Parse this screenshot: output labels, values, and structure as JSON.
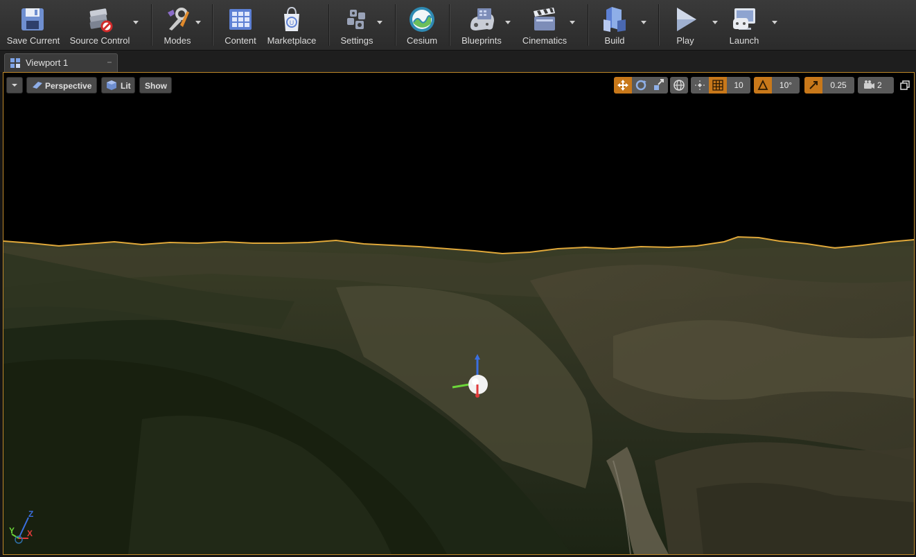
{
  "toolbar": {
    "save_current": "Save Current",
    "source_control": "Source Control",
    "modes": "Modes",
    "content": "Content",
    "marketplace": "Marketplace",
    "settings": "Settings",
    "cesium": "Cesium",
    "blueprints": "Blueprints",
    "cinematics": "Cinematics",
    "build": "Build",
    "play": "Play",
    "launch": "Launch"
  },
  "tab": {
    "label": "Viewport 1"
  },
  "viewport": {
    "perspective_label": "Perspective",
    "lit_label": "Lit",
    "show_label": "Show",
    "grid_snap_value": "10",
    "rotation_snap_value": "10°",
    "scale_snap_value": "0.25",
    "camera_speed_value": "2",
    "axis_labels": {
      "x": "X",
      "y": "Y",
      "z": "Z"
    }
  },
  "colors": {
    "accent_orange": "#c8781a",
    "viewport_border": "#c08a2a",
    "horizon_line": "#e0a83a"
  }
}
